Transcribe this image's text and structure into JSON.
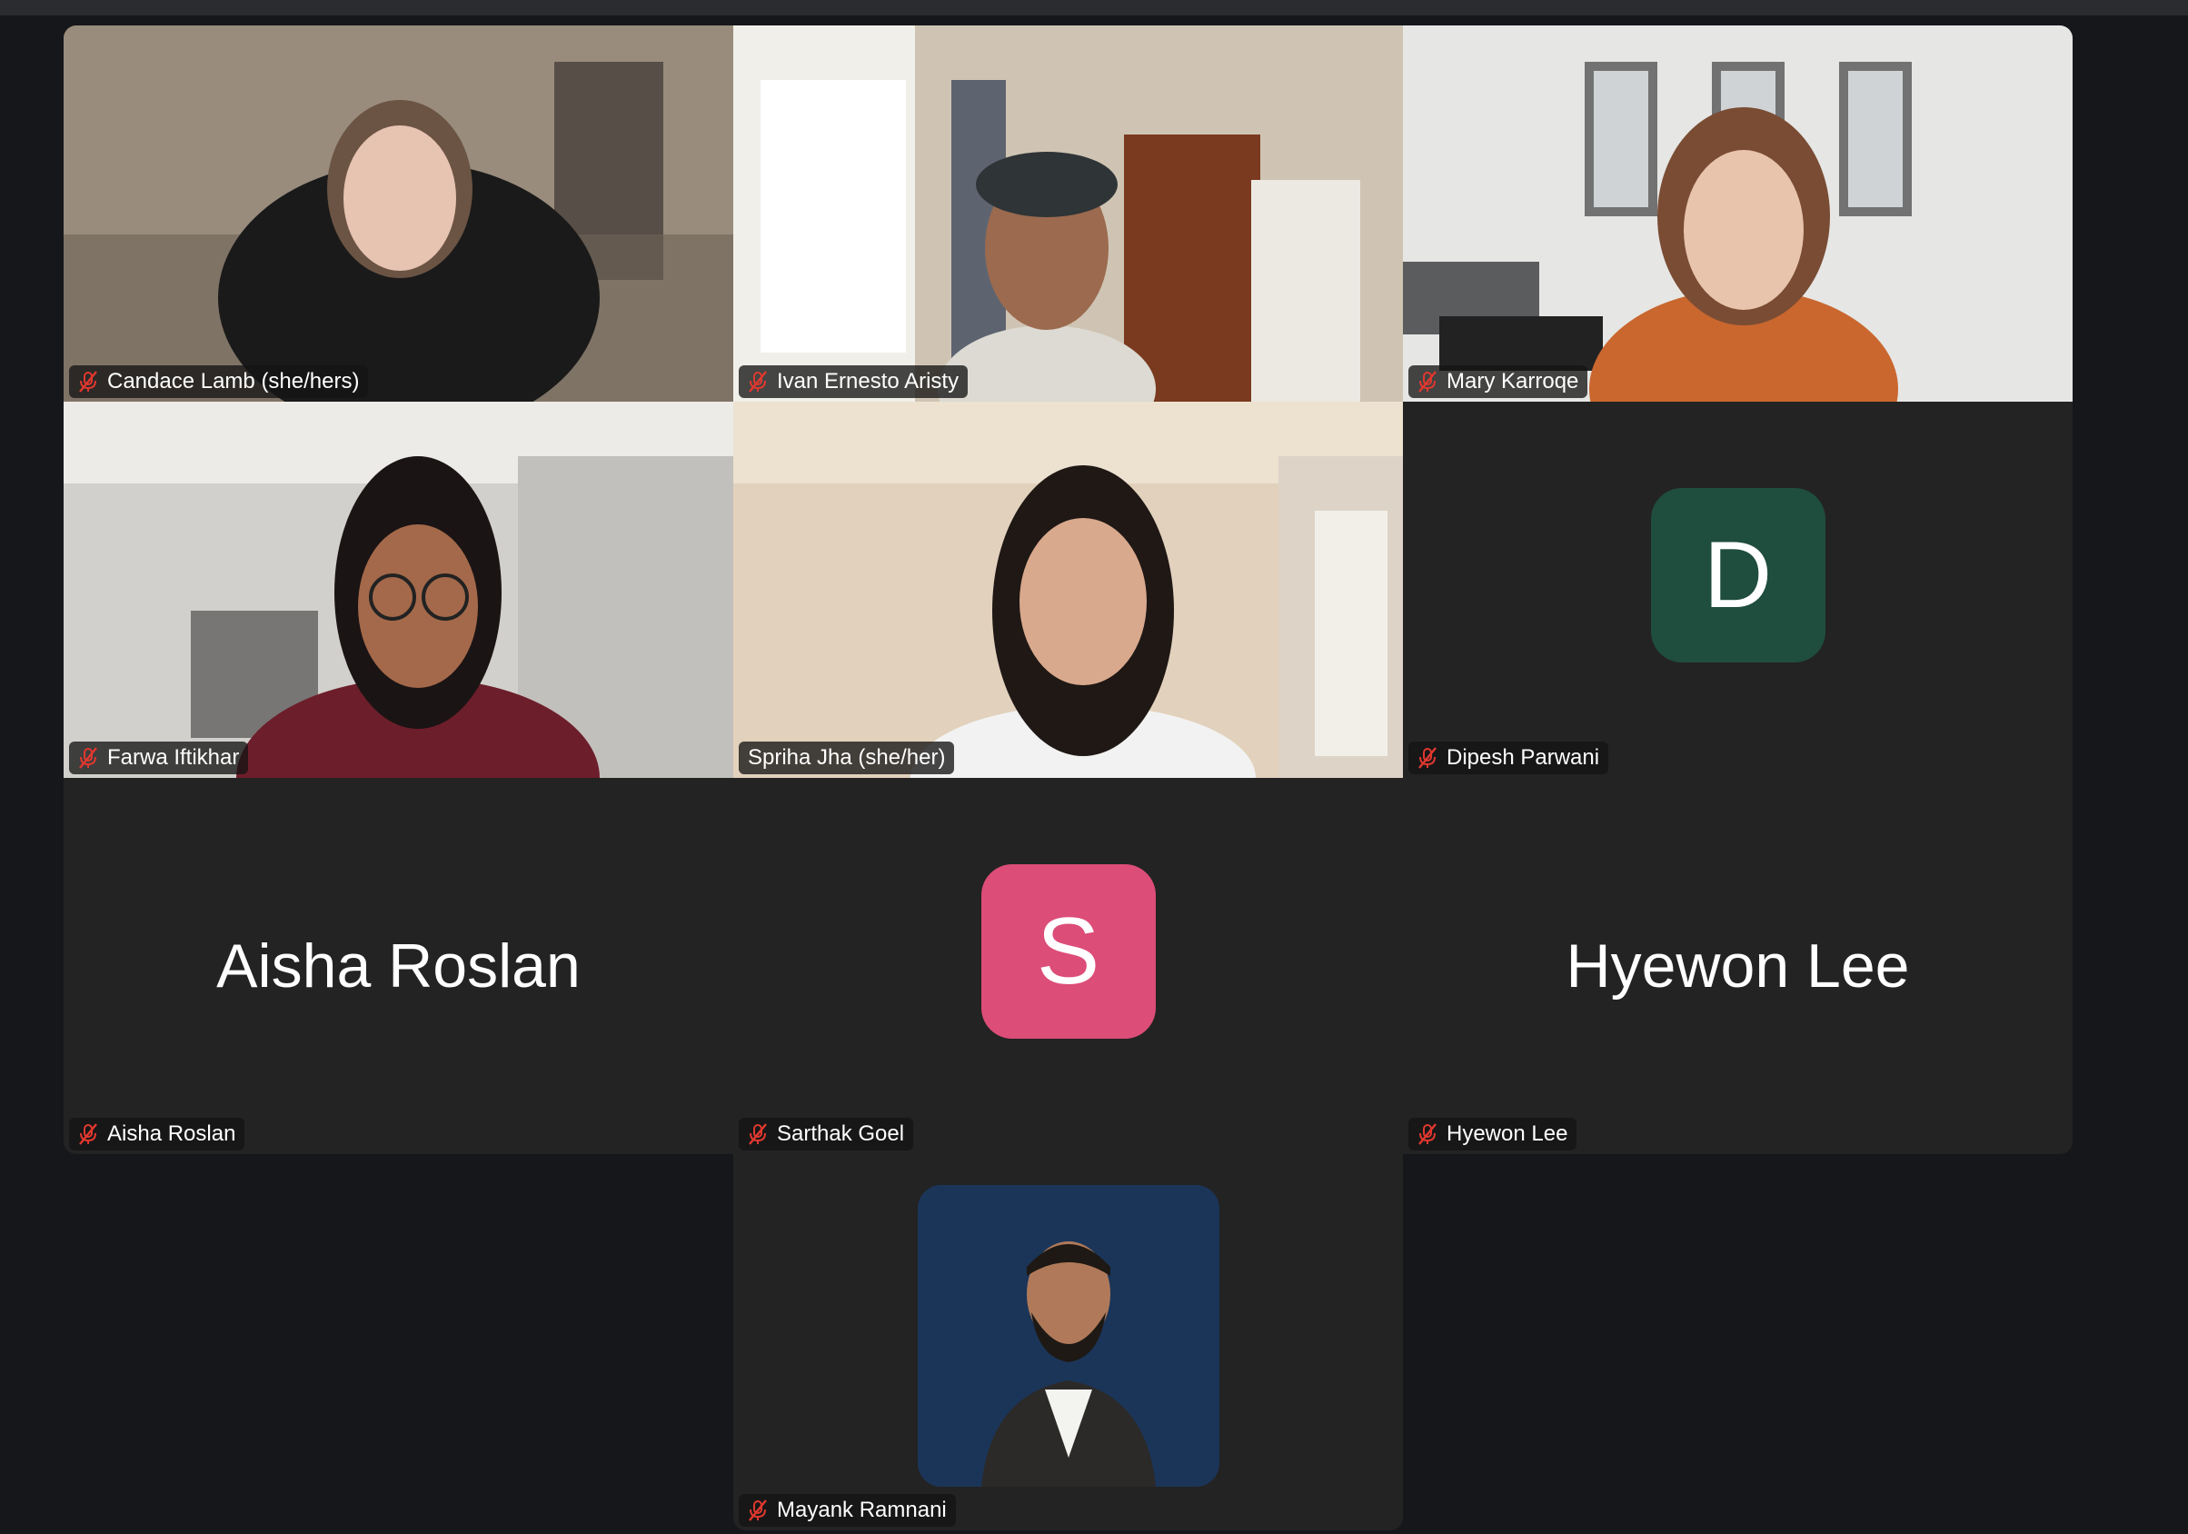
{
  "app": "Zoom meeting gallery view",
  "colors": {
    "background": "#16171b",
    "tile": "#232323",
    "active_speaker_border": "#5fd35a",
    "muted_icon": "#e0382f",
    "avatar_d": "#1f4d3e",
    "avatar_s": "#dc4d78"
  },
  "participants": [
    {
      "name": "Candace Lamb (she/hers)",
      "muted": true,
      "video": true
    },
    {
      "name": "Ivan Ernesto Aristy",
      "muted": true,
      "video": true
    },
    {
      "name": "Mary Karroqe",
      "muted": true,
      "video": true
    },
    {
      "name": "Farwa Iftikhar",
      "muted": true,
      "video": true
    },
    {
      "name": "Spriha Jha (she/her)",
      "muted": false,
      "video": true,
      "active_speaker": true
    },
    {
      "name": "Dipesh Parwani",
      "muted": true,
      "video": false,
      "avatar_letter": "D"
    },
    {
      "name": "Aisha Roslan",
      "muted": true,
      "video": false,
      "display_name": "Aisha Roslan"
    },
    {
      "name": "Sarthak Goel",
      "muted": true,
      "video": false,
      "avatar_letter": "S"
    },
    {
      "name": "Hyewon Lee",
      "muted": true,
      "video": false,
      "display_name": "Hyewon Lee"
    },
    {
      "name": "Mayank Ramnani",
      "muted": true,
      "video": false,
      "profile_photo": true
    }
  ]
}
